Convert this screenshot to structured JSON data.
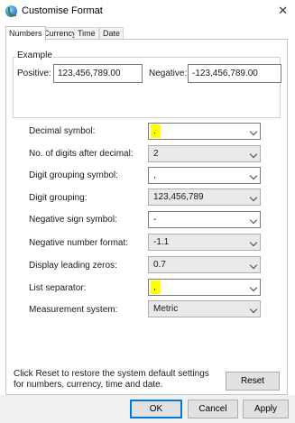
{
  "window": {
    "title": "Customise Format"
  },
  "tabs": [
    {
      "label": "Numbers",
      "active": true
    },
    {
      "label": "Currency",
      "active": false
    },
    {
      "label": "Time",
      "active": false
    },
    {
      "label": "Date",
      "active": false
    }
  ],
  "example": {
    "group_label": "Example",
    "positive_label": "Positive:",
    "positive_value": "123,456,789.00",
    "negative_label": "Negative:",
    "negative_value": "-123,456,789.00"
  },
  "settings": {
    "decimal_symbol": {
      "label": "Decimal symbol:",
      "value": "."
    },
    "digits_after_decimal": {
      "label": "No. of digits after decimal:",
      "value": "2"
    },
    "digit_grouping_symbol": {
      "label": "Digit grouping symbol:",
      "value": ","
    },
    "digit_grouping": {
      "label": "Digit grouping:",
      "value": "123,456,789"
    },
    "negative_sign_symbol": {
      "label": "Negative sign symbol:",
      "value": "-"
    },
    "negative_number_format": {
      "label": "Negative number format:",
      "value": "-1.1"
    },
    "display_leading_zeros": {
      "label": "Display leading zeros:",
      "value": "0.7"
    },
    "list_separator": {
      "label": "List separator:",
      "value": ","
    },
    "measurement_system": {
      "label": "Measurement system:",
      "value": "Metric"
    }
  },
  "footer": {
    "text": "Click Reset to restore the system default settings for numbers, currency, time and date.",
    "reset_label": "Reset"
  },
  "buttons": {
    "ok": "OK",
    "cancel": "Cancel",
    "apply": "Apply"
  },
  "colors": {
    "highlight": "#ffff00",
    "focus_border": "#0078d7"
  },
  "icons": {
    "app": "globe-clock-icon",
    "close": "close-icon",
    "dropdown": "chevron-down-icon"
  }
}
